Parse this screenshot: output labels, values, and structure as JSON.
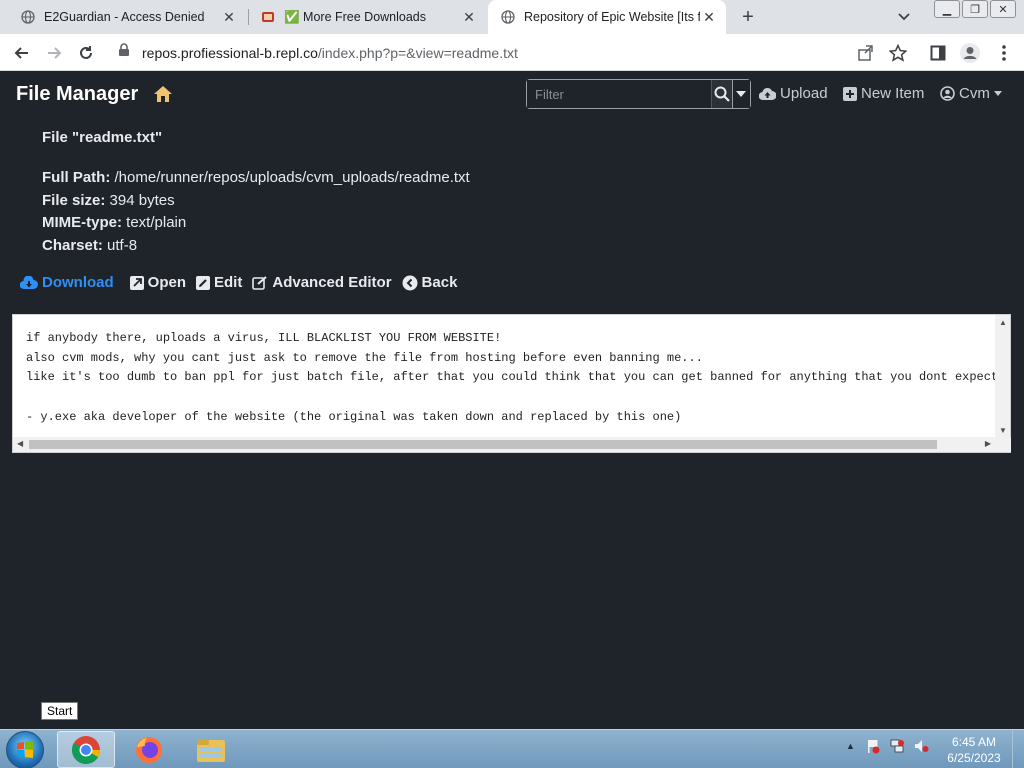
{
  "browser": {
    "tabs": [
      {
        "title": "E2Guardian - Access Denied",
        "active": false
      },
      {
        "title": "✅ More Free Downloads",
        "active": false
      },
      {
        "title": "Repository of Epic Website [Its fr",
        "active": true
      }
    ],
    "url_host": "repos.profiessional-b.repl.co",
    "url_path": "/index.php?p=&view=readme.txt"
  },
  "app": {
    "brand": "File Manager",
    "filter_placeholder": "Filter",
    "nav": {
      "upload": "Upload",
      "new_item": "New Item",
      "user": "Cvm"
    }
  },
  "file": {
    "title": "File \"readme.txt\"",
    "full_path_label": "Full Path:",
    "full_path": "/home/runner/repos/uploads/cvm_uploads/readme.txt",
    "size_label": "File size:",
    "size": "394 bytes",
    "mime_label": "MIME-type:",
    "mime": "text/plain",
    "charset_label": "Charset:",
    "charset": "utf-8"
  },
  "actions": {
    "download": "Download",
    "open": "Open",
    "edit": "Edit",
    "advanced_editor": "Advanced Editor",
    "back": "Back"
  },
  "viewer": {
    "content": "if anybody there, uploads a virus, ILL BLACKLIST YOU FROM WEBSITE!\nalso cvm mods, why you cant just ask to remove the file from hosting before even banning me...\nlike it's too dumb to ban ppl for just batch file, after that you could think that you can get banned for anything that you dont expect\n\n- y.exe aka developer of the website (the original was taken down and replaced by this one)"
  },
  "tooltip": "Start",
  "taskbar": {
    "time": "6:45 AM",
    "date": "6/25/2023"
  },
  "colors": {
    "page_bg": "#1f242b",
    "accent": "#2f8ff4"
  }
}
